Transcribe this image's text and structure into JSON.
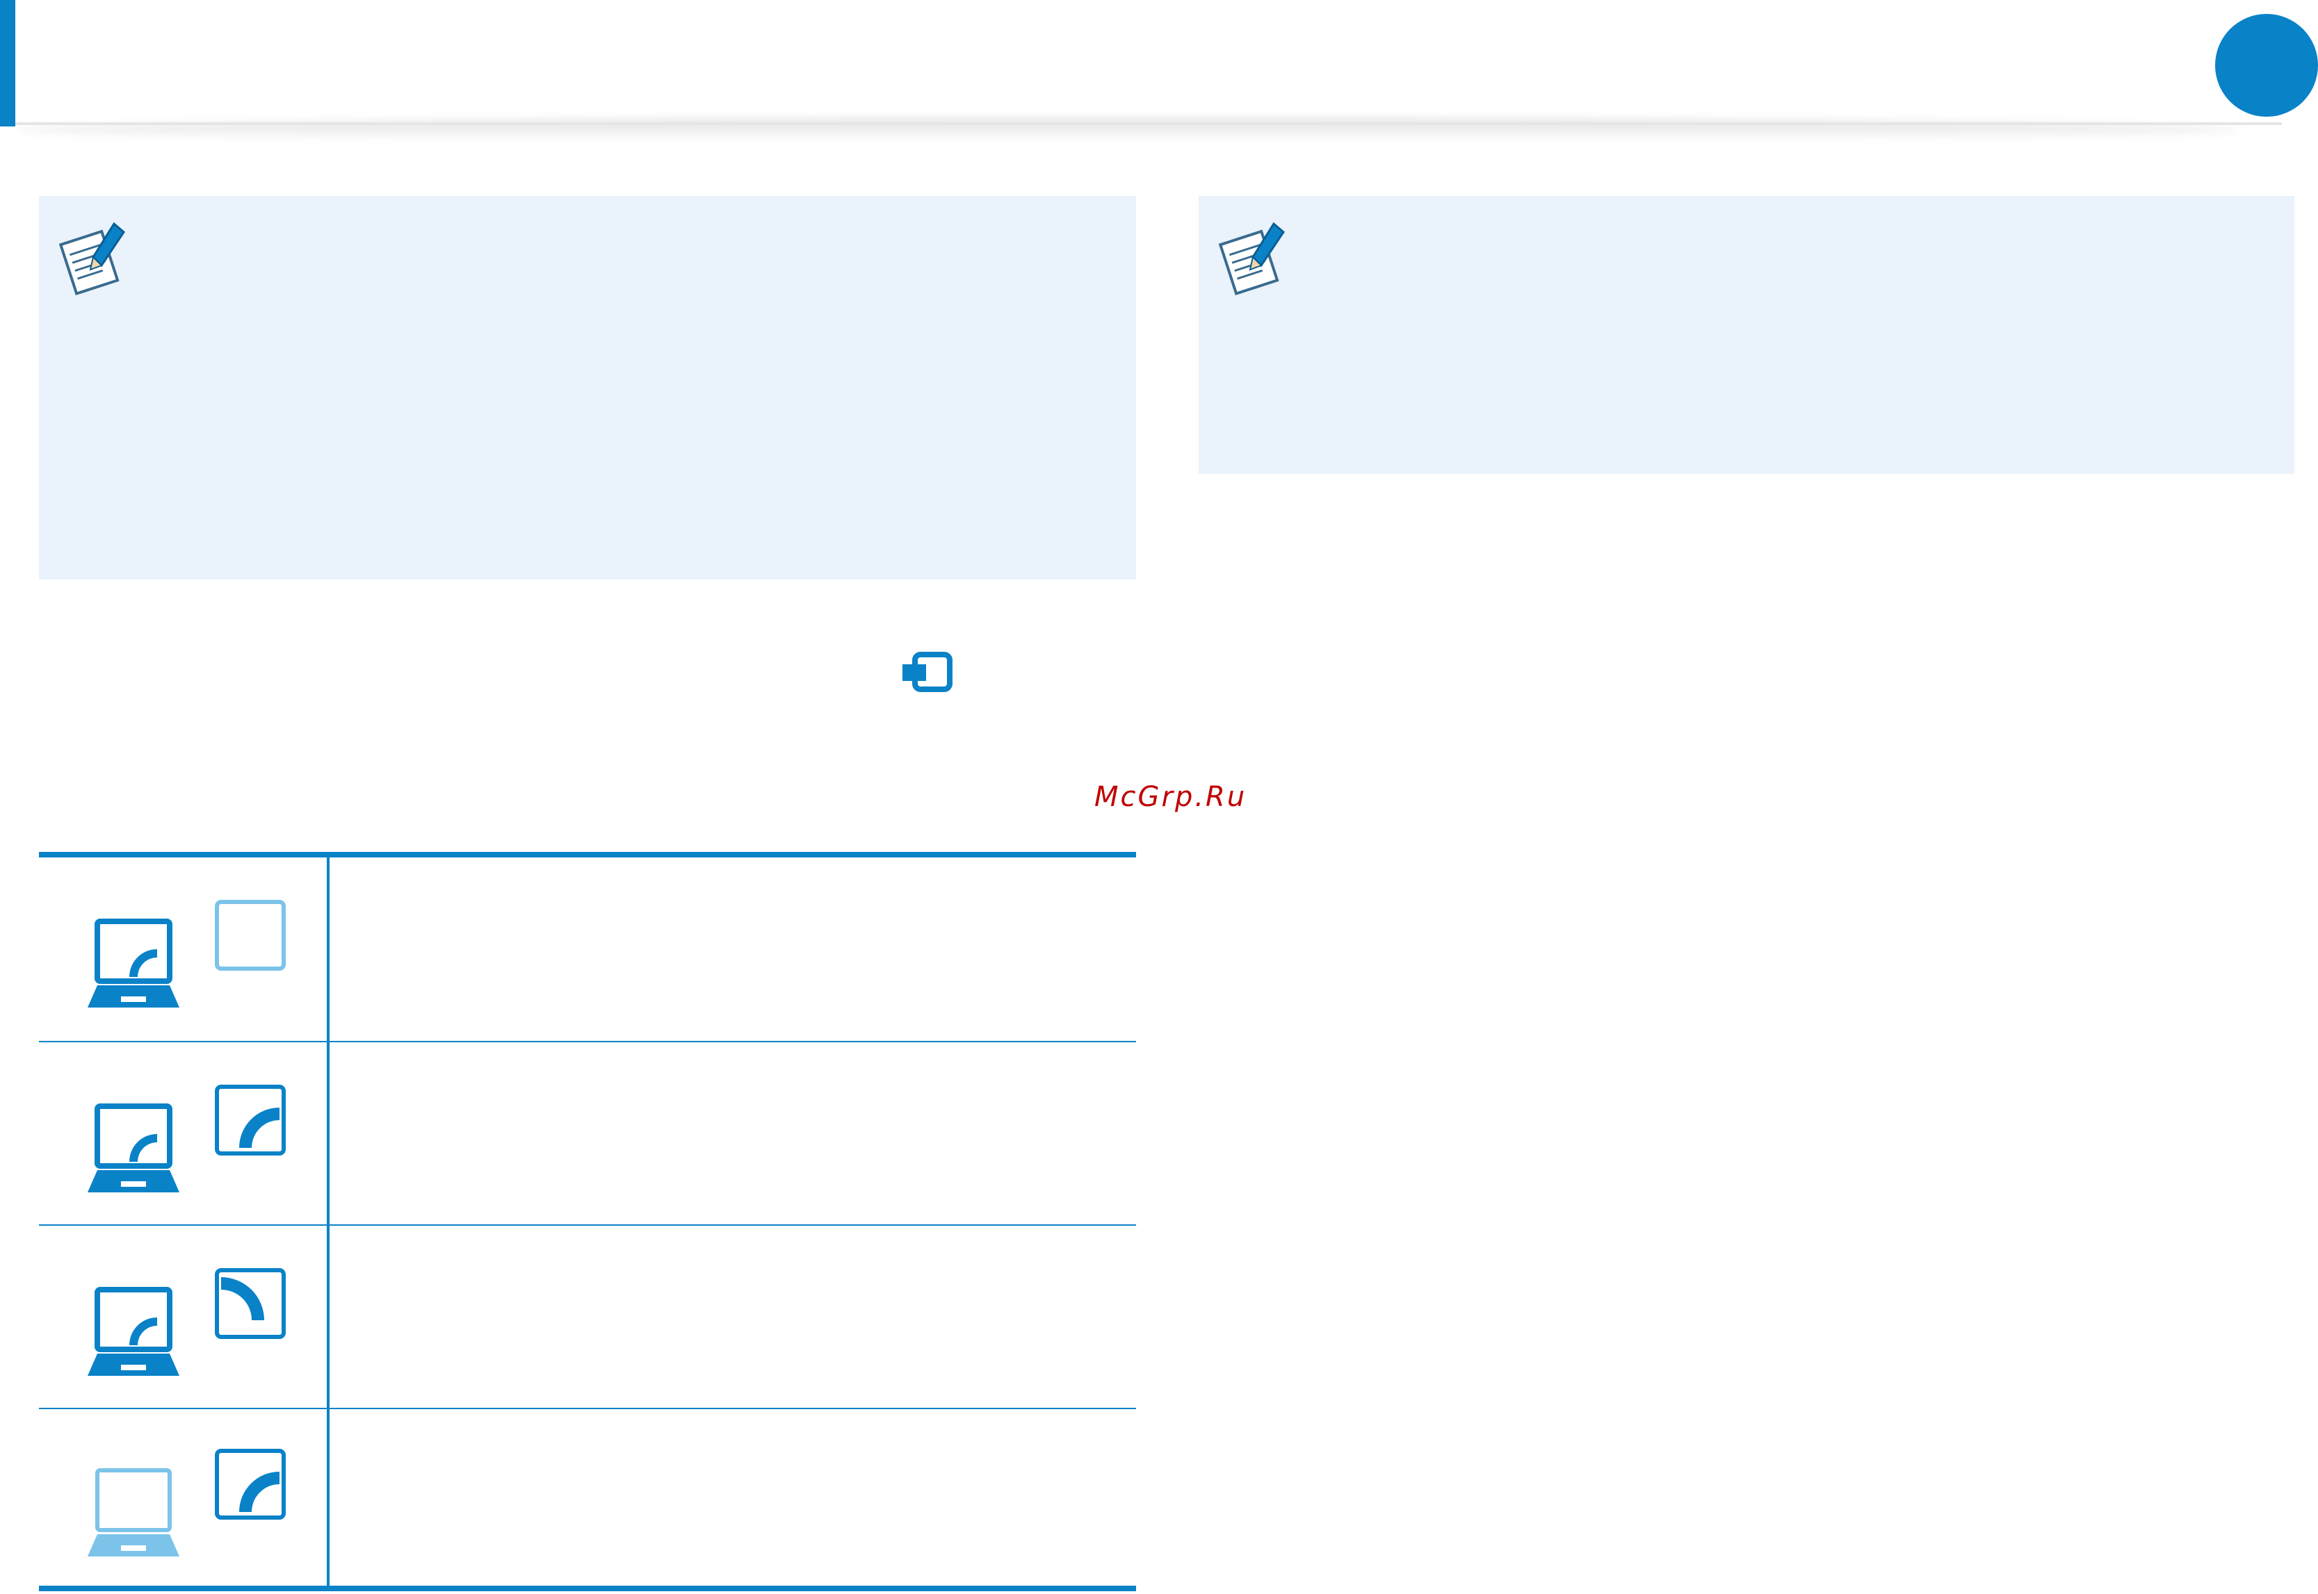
{
  "watermark": "McGrp.Ru",
  "colors": {
    "accent": "#0a82c8",
    "accent_light": "#7cc3ea",
    "note_background": "#eaf3fb",
    "watermark": "#c00000"
  },
  "icons": {
    "note": "note-pencil-icon",
    "display_key": "display-switch-key-icon",
    "modes": [
      "pc-screen-only-icon",
      "duplicate-screen-icon",
      "extend-screen-icon",
      "second-screen-only-icon"
    ]
  }
}
